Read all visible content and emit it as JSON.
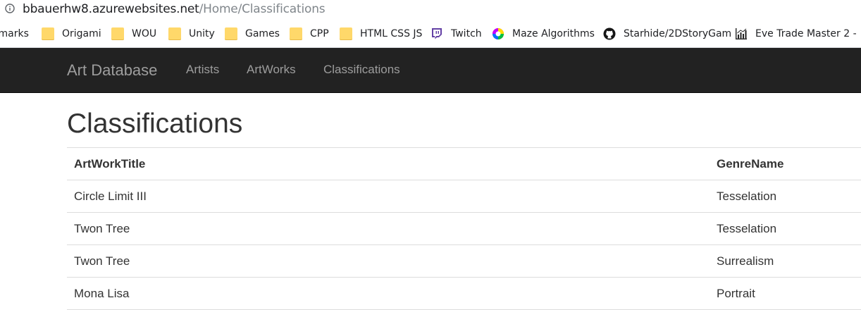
{
  "browser": {
    "url_host": "bbauerhw8.azurewebsites.net",
    "url_path": "/Home/Classifications"
  },
  "bookmarks": [
    {
      "label": "tmarks",
      "icon": "none"
    },
    {
      "label": "Origami",
      "icon": "folder-icon"
    },
    {
      "label": "WOU",
      "icon": "folder-icon"
    },
    {
      "label": "Unity",
      "icon": "folder-icon"
    },
    {
      "label": "Games",
      "icon": "folder-icon"
    },
    {
      "label": "CPP",
      "icon": "folder-icon"
    },
    {
      "label": "HTML CSS JS",
      "icon": "folder-icon"
    },
    {
      "label": "Twitch",
      "icon": "twitch-icon"
    },
    {
      "label": "Maze Algorithms",
      "icon": "maze-color-wheel-icon"
    },
    {
      "label": "Starhide/2DStoryGam",
      "icon": "github-icon"
    },
    {
      "label": "Eve Trade Master 2 -",
      "icon": "chart-icon"
    }
  ],
  "navbar": {
    "brand": "Art Database",
    "links": [
      "Artists",
      "ArtWorks",
      "Classifications"
    ]
  },
  "page": {
    "title": "Classifications"
  },
  "table": {
    "headers": [
      "ArtWorkTitle",
      "GenreName"
    ],
    "rows": [
      [
        "Circle Limit III",
        "Tesselation"
      ],
      [
        "Twon Tree",
        "Tesselation"
      ],
      [
        "Twon Tree",
        "Surrealism"
      ],
      [
        "Mona Lisa",
        "Portrait"
      ]
    ]
  },
  "colors": {
    "navbar_bg": "#222222",
    "nav_text": "#9d9d9d",
    "text": "#333333",
    "folder": "#ffd86a"
  }
}
